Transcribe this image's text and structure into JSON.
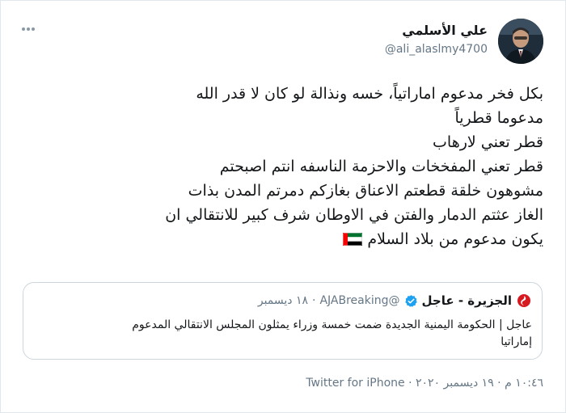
{
  "author": {
    "display_name": "علي الأسلمي",
    "username": "@ali_alaslmy4700"
  },
  "tweet": {
    "lines": [
      "بكل فخر مدعوم اماراتياً، خسه ونذالة لو كان لا قدر الله",
      "مدعوما قطرياً",
      "قطر تعني لارهاب",
      "قطر تعني المفخخات والاحزمة الناسفه انتم اصبحتم",
      "مشوهون خلقة قطعتم الاعناق بغازكم دمرتم المدن بذات",
      "الغاز عثتم الدمار والفتن في الاوطان شرف كبير للانتقالي ان",
      "يكون مدعوم من بلاد السلام"
    ],
    "flag_emoji": "uae-flag-icon"
  },
  "quote": {
    "name": "الجزيرة - عاجل",
    "handle": "@AJABreaking",
    "separator": "·",
    "date": "١٨ ديسمبر",
    "lines": [
      "عاجل | الحكومة اليمنية الجديدة ضمت خمسة وزراء  يمثلون المجلس الانتقالي المدعوم",
      "إماراتيا"
    ]
  },
  "footer": {
    "time": "١٠:٤٦ م",
    "separator": "·",
    "date": "١٩ ديسمبر ٢٠٢٠",
    "source": "Twitter for iPhone"
  },
  "colors": {
    "text": "#14171a",
    "secondary": "#657786",
    "verified": "#1da1f2",
    "aljazeera": "#d71920",
    "border": "#ccd6dd"
  }
}
